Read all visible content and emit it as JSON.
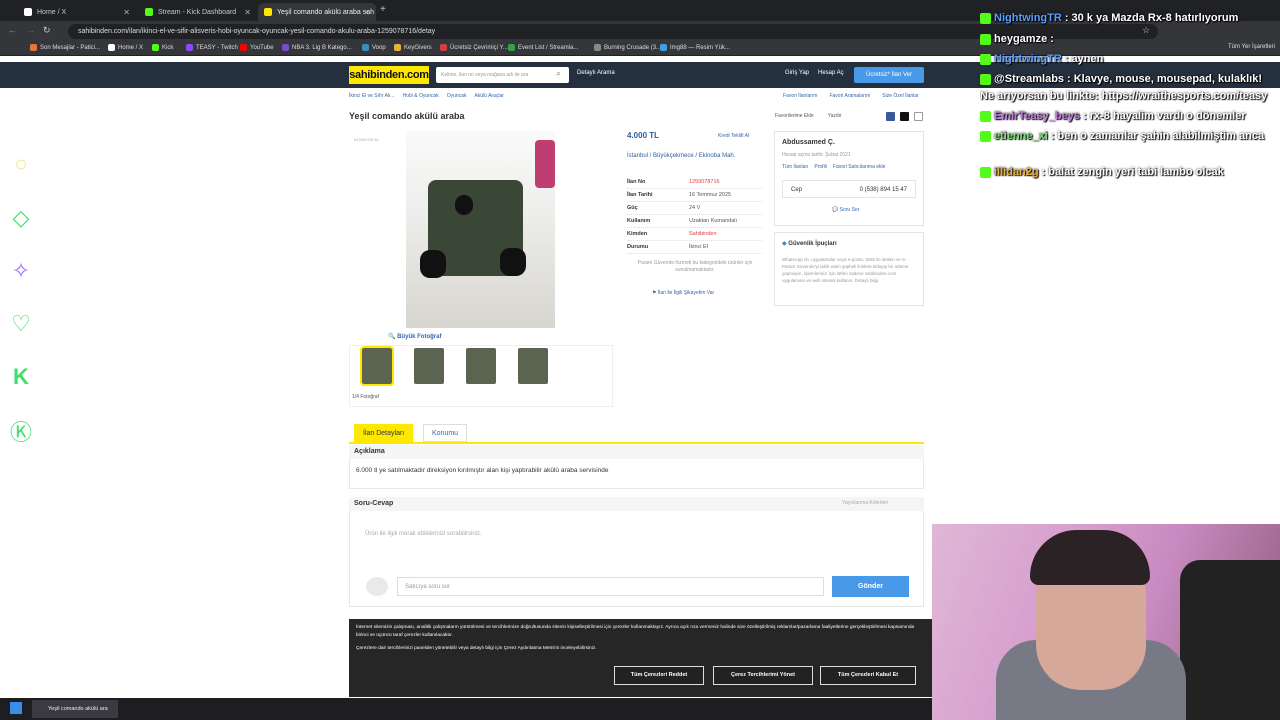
{
  "browser": {
    "tabs": [
      {
        "label": "Home / X",
        "icon": "x-logo-icon",
        "color": "#ffffff"
      },
      {
        "label": "Stream - Kick Dashboard",
        "icon": "kick-icon",
        "color": "#53fc18"
      },
      {
        "label": "Yeşil comando akülü araba sah",
        "icon": "sahibinden-icon",
        "color": "#ffe800"
      }
    ],
    "url": "sahibinden.com/ilan/ikinci-el-ve-sifir-alisveris-hobi-oyuncak-oyuncak-yesil-comando-akulu-araba-1259078716/detay",
    "bookmarks": [
      "Son Mesajlar - Patici...",
      "Home / X",
      "Kick",
      "TEASY - Twitch",
      "YouTube",
      "NBA 3. Lig B Katego...",
      "Voop",
      "KeyGivers",
      "Ücretsiz Çevrimiçi Y...",
      "Event List / Streamla...",
      "Burning Crusade (3...",
      "Img88 — Resim Yük..."
    ],
    "bookmark_colors": [
      "#e8753a",
      "#ffffff",
      "#53fc18",
      "#9146ff",
      "#ff0000",
      "#7b4cc9",
      "#3c8dbc",
      "#e8b23a",
      "#d04040",
      "#2ca44f",
      "#888888",
      "#3aa0e8"
    ],
    "all_bookmarks": "Tüm Yer İşaretleri"
  },
  "site": {
    "logo": "sahibinden.com",
    "search_placeholder": "Kelime, ilan no veya mağaza adı ile ara",
    "detailed_search": "Detaylı Arama",
    "login": "Giriş Yap",
    "register": "Hesap Aç",
    "post_ad": "Ücretsiz* İlan Ver",
    "breadcrumbs": [
      "İkinci El ve Sıfır Alı...",
      "Hobi & Oyuncak",
      "Oyuncak",
      "Akülü Araçlar"
    ],
    "top_links": [
      "Favori İlanlarım",
      "Favori Aramalarım",
      "Size Özel İlanlar"
    ],
    "title": "Yeşil comando akülü araba",
    "page_links": [
      "Favorilerime Ekle",
      "Yazdır"
    ],
    "ad_code": "#1259078716",
    "big_photo": "Büyük Fotoğraf",
    "photo_count": "1/4 Fotoğraf",
    "price": "4.000 TL",
    "credit_offer": "Kredi Teklifi Al",
    "location": [
      "İstanbul",
      "Büyükçekmece",
      "Ekinoba Mah."
    ],
    "specs": [
      {
        "key": "İlan No",
        "value": "1259078716",
        "red": true
      },
      {
        "key": "İlan Tarihi",
        "value": "16 Temmuz 2025",
        "red": false
      },
      {
        "key": "Güç",
        "value": "24 V",
        "red": false
      },
      {
        "key": "Kullanım",
        "value": "Uzaktan Kumandalı",
        "red": false
      },
      {
        "key": "Kimden",
        "value": "Sahibinden",
        "red": true
      },
      {
        "key": "Durumu",
        "value": "İkinci El",
        "red": false
      }
    ],
    "param_note": "Param Güvende hizmeti bu kategorideki ürünler için sunulmamaktadır.",
    "report": "İlan ile İlgili Şikayetim Var",
    "seller_name": "Abdussamed Ç.",
    "seller_since": "Hesap açma tarihi: Şubat 2021",
    "seller_links": [
      "Tüm İlanları",
      "Profili",
      "Favori Satıcılarıma ekle"
    ],
    "phone_label": "Cep",
    "phone": "0 (538) 894 15 47",
    "ask_question": "Soru Sor",
    "safety_title": "Güvenlik İpuçları",
    "safety_text": "WhatsApp vb. uygulamalar veya e-posta, SMS ile iletilen ve S-Param Güvende'yi taklit eden şüpheli linklere tıklayıp bir ödeme yapmayın. İşlemlerinizi için lütfen sadece sahibinden.com uygulaması ve web sitesini kullanın. Detaylı bilgi",
    "tabs": [
      "İlan Detayları",
      "Konumu"
    ],
    "description_head": "Açıklama",
    "description": "6.000 tl ye satılmaktadır direksiyon kırılmıştır alan kişi yaptırabilir akülü araba servisinde",
    "qa_head": "Soru-Cevap",
    "qa_rules": "Yayınlanma Kriterleri",
    "qa_empty": "Ürün ile ilgili merak ettiklerinizi sorabilirsiniz.",
    "ask_placeholder": "Satıcıya soru sor",
    "send": "Gönder"
  },
  "cookie": {
    "text": "İnternet sitemizin çalışması, analitik çalışmaların yürütülmesi ve tercihlerinize doğrultusunda sitenin kişiselleştirilmesi için çerezler kullanmaktayız. Ayrıca açık rıza vermeniz halinde size özelleştirilmiş reklamlar/pazarlama faaliyetlerine gerçekleştirilmesi kapsamında birinci ve üçüncü taraf çerezler kullanılacaktır.",
    "text2": "Çerezlere dair tercihlerinizi panelden yönetebilir veya detaylı bilgi için Çerez Aydınlatma Metni'ni inceleyebilirsiniz.",
    "reject": "Tüm Çerezleri Reddet",
    "manage": "Çerez Tercihlerimi Yönet",
    "accept": "Tüm Çerezleri Kabul Et"
  },
  "taskbar": {
    "item": "Yeşil comando akülü ara"
  },
  "chat": [
    {
      "user": "NightwingTR",
      "msg": "30 k ya Mazda Rx-8 hatırlıyorum",
      "color": "#5aa0ff"
    },
    {
      "user": "heygamze",
      "msg": "",
      "color": "#ffffff"
    },
    {
      "user": "NightwingTR",
      "msg": "aynen",
      "color": "#5aa0ff"
    },
    {
      "user": "@Streamlabs",
      "msg": "Klavye, mouse, mousepad, kulaklık!",
      "color": "#ffffff"
    },
    {
      "user": "",
      "msg": "Ne arıyorsan bu linkte: https://wraithesports.com/teasy",
      "color": "#ffffff"
    },
    {
      "user": "EmirTeasy_beys",
      "msg": "rx-8 hayalim vardı o dönemler",
      "color": "#c07bdc"
    },
    {
      "user": "etienne_xi",
      "msg": "ben o zamanlar şahin alabilmiştim anca",
      "color": "#7ddc7b"
    },
    {
      "user": "illidan2g",
      "msg": "balat zengin yeri tabi lambo olcak",
      "color": "#e8b23a"
    }
  ]
}
